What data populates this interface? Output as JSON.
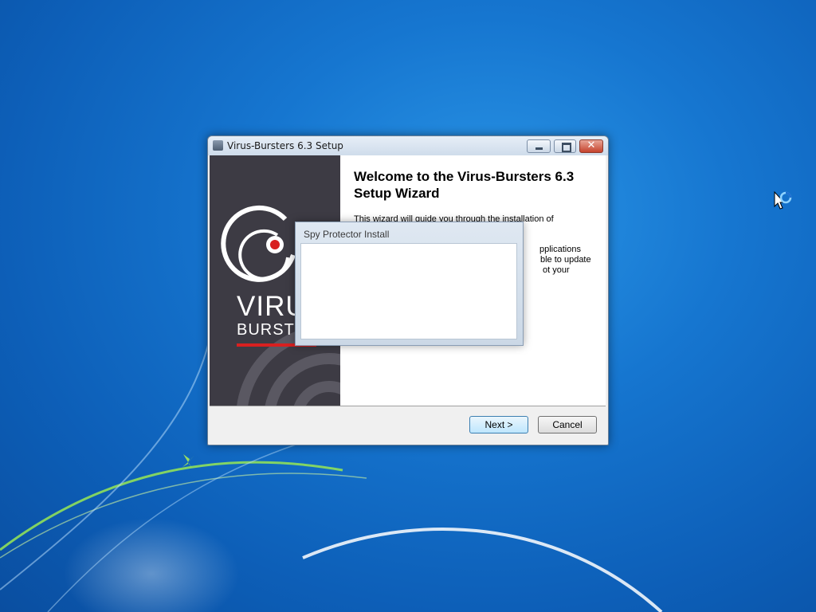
{
  "wizard": {
    "title": "Virus-Bursters 6.3 Setup",
    "heading": "Welcome to the Virus-Bursters 6.3 Setup Wizard",
    "body_lines": [
      "This wizard will guide you through the installation of",
      "pplications",
      "ble to update",
      "ot your"
    ],
    "banner": {
      "logo_line1": "VIRU",
      "logo_line2": "BURSTE"
    },
    "buttons": {
      "next": "Next >",
      "cancel": "Cancel"
    },
    "controls": {
      "close": "✕"
    }
  },
  "spy_dialog": {
    "title": "Spy Protector Install"
  },
  "colors": {
    "banner_bg": "#3d3b44",
    "accent_red": "#d82020",
    "desktop_blue": "#1676d0"
  },
  "icons": [
    "app-icon",
    "minimize-icon",
    "maximize-icon",
    "close-icon",
    "virus-bursters-logo-icon",
    "busy-cursor-icon"
  ]
}
